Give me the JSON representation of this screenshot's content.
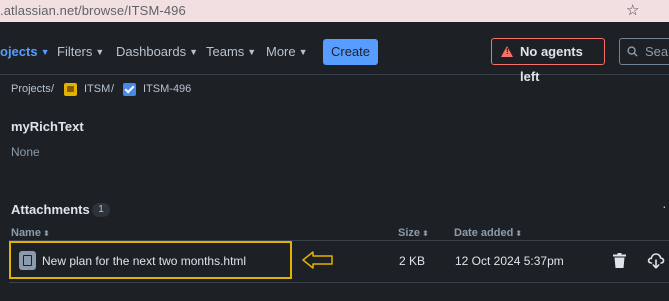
{
  "browser": {
    "url": ".atlassian.net/browse/ITSM-496"
  },
  "nav": {
    "items": [
      {
        "label": "ojects",
        "active": true
      },
      {
        "label": "Filters"
      },
      {
        "label": "Dashboards"
      },
      {
        "label": "Teams"
      },
      {
        "label": "More"
      }
    ],
    "create_label": "Create",
    "agents_label": "No agents left",
    "search_placeholder": "Sear"
  },
  "breadcrumb": {
    "projects": "Projects",
    "sep": "/",
    "project": "ITSM",
    "issue": "ITSM-496"
  },
  "field": {
    "title": "myRichText",
    "value": "None"
  },
  "attachments": {
    "title": "Attachments",
    "count": "1",
    "columns": {
      "name": "Name",
      "size": "Size",
      "date": "Date added"
    },
    "rows": [
      {
        "name": "New plan for the next two months.html",
        "size": "2 KB",
        "date": "12 Oct 2024 5:37pm"
      }
    ]
  },
  "colors": {
    "accent": "#579dff",
    "warning": "#f87168",
    "highlight": "#e2b203",
    "background": "#1d2125"
  },
  "icons": {
    "star": "star-icon",
    "warning": "warning-icon",
    "search": "search-icon",
    "file": "file-icon",
    "trash": "trash-icon",
    "download": "cloud-download-icon"
  }
}
